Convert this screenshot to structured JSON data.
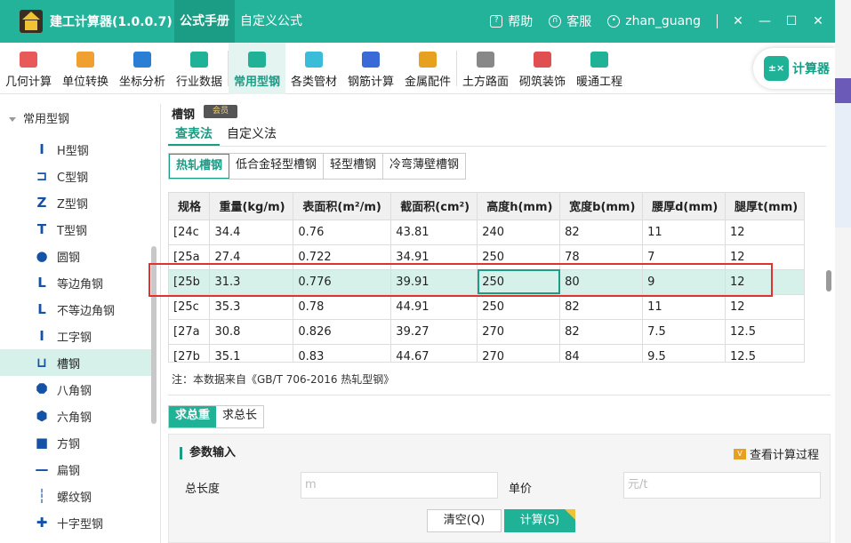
{
  "app": {
    "title": "建工计算器(1.0.0.7)",
    "nav": [
      "公式手册",
      "自定义公式"
    ],
    "active_nav": 0
  },
  "titlebar": {
    "help": "帮助",
    "service": "客服",
    "user": "zhan_guang",
    "pin_icon": "pin-icon",
    "min_icon": "minimize-icon",
    "max_icon": "maximize-icon",
    "close_icon": "close-icon"
  },
  "toolbar": {
    "items": [
      {
        "label": "几何计算",
        "icon": "cube-icon",
        "color": "#e85a5a"
      },
      {
        "label": "单位转换",
        "icon": "unit-icon",
        "color": "#f0a030"
      },
      {
        "label": "坐标分析",
        "icon": "axis-icon",
        "color": "#2a7fd4"
      },
      {
        "label": "行业数据",
        "icon": "chart-icon",
        "color": "#1fb297"
      },
      {
        "label": "常用型钢",
        "icon": "tools-icon",
        "color": "#1fb297"
      },
      {
        "label": "各类管材",
        "icon": "pipe-icon",
        "color": "#3bbcd8"
      },
      {
        "label": "钢筋计算",
        "icon": "rebar-icon",
        "color": "#3a6ad8"
      },
      {
        "label": "金属配件",
        "icon": "hammer-icon",
        "color": "#e8a020"
      },
      {
        "label": "土方路面",
        "icon": "road-icon",
        "color": "#888888"
      },
      {
        "label": "砌筑装饰",
        "icon": "brick-icon",
        "color": "#e05050"
      },
      {
        "label": "暖通工程",
        "icon": "fan-icon",
        "color": "#1fb297"
      }
    ],
    "active": 4,
    "calculator": "计算器"
  },
  "sidebar": {
    "group": "常用型钢",
    "items": [
      {
        "label": "H型钢",
        "glyph": "I"
      },
      {
        "label": "C型钢",
        "glyph": "⊐"
      },
      {
        "label": "Z型钢",
        "glyph": "Z"
      },
      {
        "label": "T型钢",
        "glyph": "T"
      },
      {
        "label": "圆钢",
        "glyph": "●"
      },
      {
        "label": "等边角钢",
        "glyph": "L"
      },
      {
        "label": "不等边角钢",
        "glyph": "L"
      },
      {
        "label": "工字钢",
        "glyph": "I"
      },
      {
        "label": "槽钢",
        "glyph": "⊔"
      },
      {
        "label": "八角钢",
        "glyph": "⯃"
      },
      {
        "label": "六角钢",
        "glyph": "⬢"
      },
      {
        "label": "方钢",
        "glyph": "■"
      },
      {
        "label": "扁钢",
        "glyph": "—"
      },
      {
        "label": "螺纹钢",
        "glyph": "┆"
      },
      {
        "label": "十字型钢",
        "glyph": "✚"
      }
    ],
    "active": 8
  },
  "main": {
    "title": "槽钢",
    "vip_badge": "会员",
    "tabs": [
      "查表法",
      "自定义法"
    ],
    "active_tab": 0,
    "subtabs": [
      "热轧槽钢",
      "低合金轻型槽钢",
      "轻型槽钢",
      "冷弯薄壁槽钢"
    ],
    "active_subtab": 0,
    "table": {
      "headers": [
        "规格",
        "重量(kg/m)",
        "表面积(m²/m)",
        "截面积(cm²)",
        "高度h(mm)",
        "宽度b(mm)",
        "腰厚d(mm)",
        "腿厚t(mm)"
      ],
      "rows": [
        [
          "[24c",
          "34.4",
          "0.76",
          "43.81",
          "240",
          "82",
          "11",
          "12"
        ],
        [
          "[25a",
          "27.4",
          "0.722",
          "34.91",
          "250",
          "78",
          "7",
          "12"
        ],
        [
          "[25b",
          "31.3",
          "0.776",
          "39.91",
          "250",
          "80",
          "9",
          "12"
        ],
        [
          "[25c",
          "35.3",
          "0.78",
          "44.91",
          "250",
          "82",
          "11",
          "12"
        ],
        [
          "[27a",
          "30.8",
          "0.826",
          "39.27",
          "270",
          "82",
          "7.5",
          "12.5"
        ],
        [
          "[27b",
          "35.1",
          "0.83",
          "44.67",
          "270",
          "84",
          "9.5",
          "12.5"
        ]
      ],
      "selected_row": 2
    },
    "note": "注：本数据来自《GB/T 706-2016 热轧型钢》",
    "calc_tabs": [
      "求总重",
      "求总长"
    ],
    "active_calc_tab": 0,
    "panel": {
      "title": "参数输入",
      "process_link": "查看计算过程",
      "length_label": "总长度",
      "length_placeholder": "m",
      "price_label": "单价",
      "price_placeholder": "元/t",
      "clear_button": "清空(Q)",
      "calc_button": "计算(S)"
    }
  },
  "colors": {
    "accent": "#23b39a",
    "selected_row": "#d6f0ea",
    "highlight_box": "#e0332f"
  }
}
